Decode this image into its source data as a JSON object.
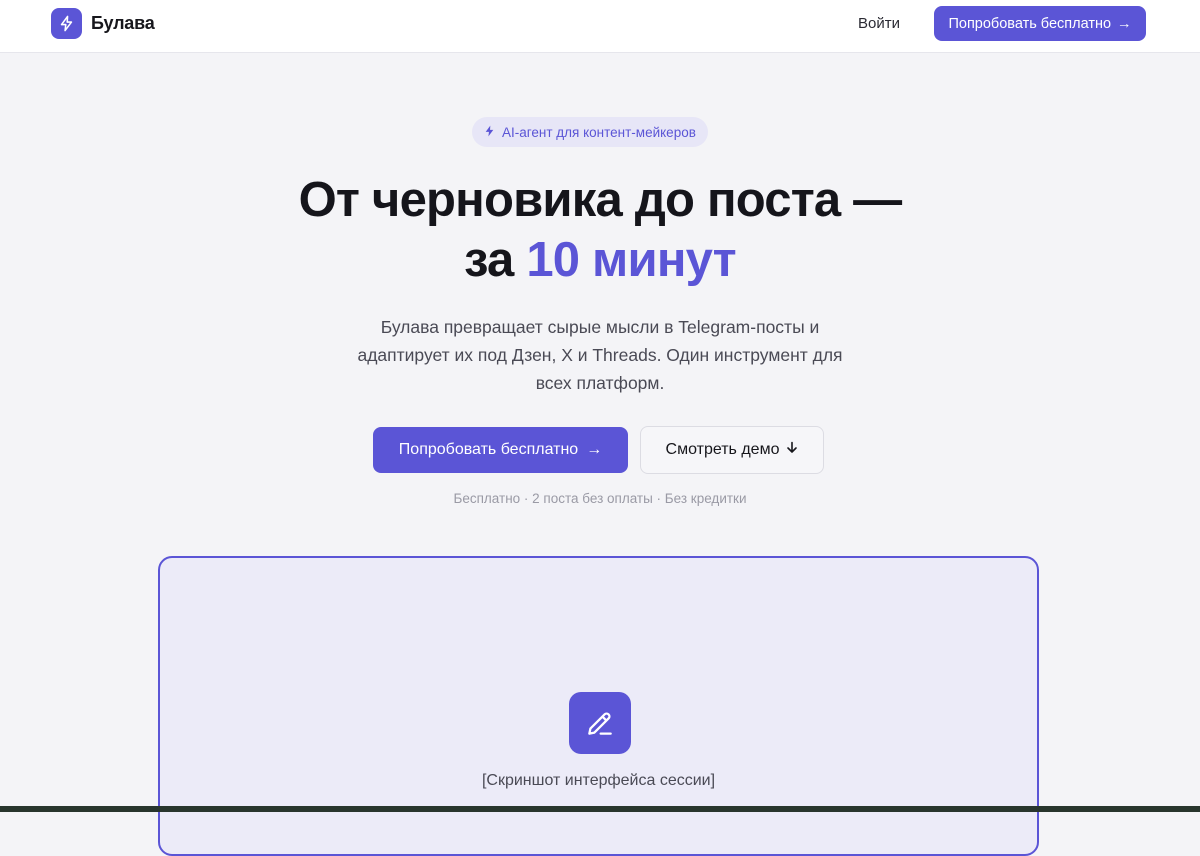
{
  "header": {
    "brand_name": "Булава",
    "brand_icon": "lightning-icon",
    "login_label": "Войти",
    "cta_label": "Попробовать бесплатно",
    "cta_arrow": "→"
  },
  "hero": {
    "badge_icon": "lightning-icon",
    "badge_text": "AI-агент для контент-мейкеров",
    "title_line1": "От черновика до поста —",
    "title_line2_prefix": "за ",
    "title_line2_accent": "10 минут",
    "subtitle": "Булава превращает сырые мысли в Telegram-посты и адаптирует их под Дзен, X и Threads. Один инструмент для всех платформ.",
    "primary_button_label": "Попробовать бесплатно",
    "primary_button_arrow": "→",
    "secondary_button_label": "Смотреть демо",
    "secondary_button_arrow": "↓",
    "note": "Бесплатно · 2 поста без оплаты · Без кредитки"
  },
  "preview": {
    "icon": "pencil-icon",
    "caption": "[Скриншот интерфейса сессии]"
  },
  "colors": {
    "accent": "#5b55d6",
    "page_background": "#f4f4f7",
    "preview_background": "#ecebf8"
  }
}
